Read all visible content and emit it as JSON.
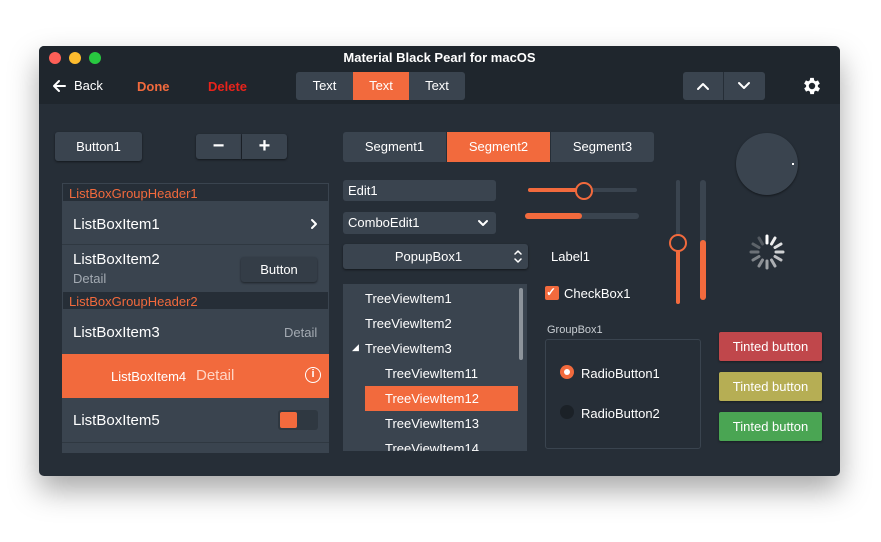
{
  "window": {
    "title": "Material Black Pearl for macOS"
  },
  "toolbar": {
    "back_label": "Back",
    "done_label": "Done",
    "delete_label": "Delete",
    "segments": [
      "Text",
      "Text",
      "Text"
    ],
    "selected_segment": 1
  },
  "buttons": {
    "button1": "Button1",
    "minus": "−",
    "plus": "+"
  },
  "segmented": {
    "items": [
      "Segment1",
      "Segment2",
      "Segment3"
    ],
    "selected": 1
  },
  "listbox": {
    "header1": "ListBoxGroupHeader1",
    "header2": "ListBoxGroupHeader2",
    "item1": "ListBoxItem1",
    "item2": "ListBoxItem2",
    "item2_detail": "Detail",
    "item2_button": "Button",
    "item3": "ListBoxItem3",
    "item3_detail": "Detail",
    "item4": "ListBoxItem4",
    "item4_detail": "Detail",
    "item5": "ListBoxItem5"
  },
  "edit1": {
    "value": "Edit1"
  },
  "comboedit1": {
    "value": "ComboEdit1"
  },
  "popupbox1": {
    "value": "PopupBox1"
  },
  "treeview": {
    "items": [
      "TreeViewItem1",
      "TreeViewItem2",
      "TreeViewItem3",
      "TreeViewItem11",
      "TreeViewItem12",
      "TreeViewItem13",
      "TreeViewItem14"
    ],
    "expand_glyph": "◢",
    "selected": "TreeViewItem12"
  },
  "sliders": {
    "h_track_value": 0.5,
    "h_progress_value": 0.5,
    "v_track_value": 0.5,
    "v_progress_value": 0.5
  },
  "label1": "Label1",
  "checkbox1": {
    "label": "CheckBox1",
    "checked": true,
    "check_glyph": "✓"
  },
  "groupbox1": {
    "title": "GroupBox1",
    "radio1": "RadioButton1",
    "radio2": "RadioButton2",
    "selected": "RadioButton1"
  },
  "tinted": {
    "red": "Tinted button",
    "yellow": "Tinted button",
    "green": "Tinted button"
  },
  "icons": {
    "gear": "gear-icon",
    "back": "arrow-left-icon",
    "info": "info-icon",
    "info_glyph": "i",
    "chevron_up": "chevron-up-icon",
    "chevron_down": "chevron-down-icon",
    "activity": "activity-indicator-icon"
  },
  "colors": {
    "accent": "#f26a3d",
    "background": "#262e37",
    "control": "#3a444f",
    "done": "#f26a3d",
    "delete": "#e8231b",
    "tint_red": "#c0474b",
    "tint_yellow": "#b6ae54",
    "tint_green": "#4aa553"
  }
}
